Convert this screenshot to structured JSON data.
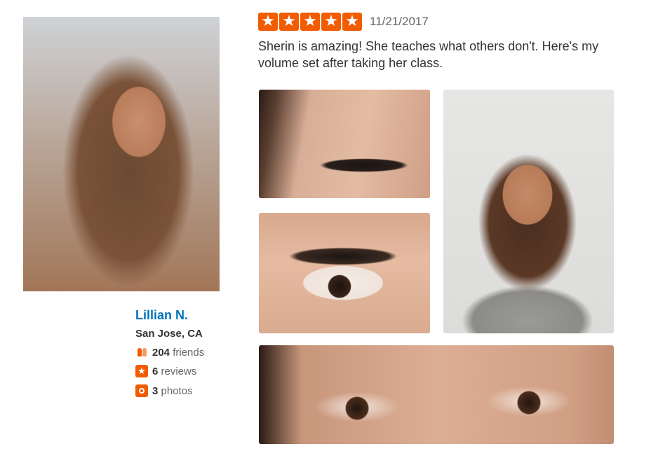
{
  "user": {
    "name": "Lillian N.",
    "location": "San Jose, CA",
    "friends_count": "204",
    "friends_label": "friends",
    "reviews_count": "6",
    "reviews_label": "reviews",
    "photos_count": "3",
    "photos_label": "photos"
  },
  "review": {
    "rating": 5,
    "star_glyph": "★",
    "date": "11/21/2017",
    "text": "Sherin is amazing! She teaches what others don't. Here's my volume set after taking her class."
  },
  "colors": {
    "accent": "#f15c00",
    "name_link": "#0073bb"
  }
}
